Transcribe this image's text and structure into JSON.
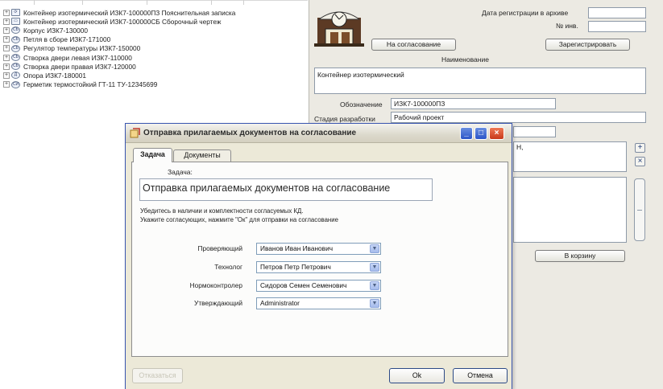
{
  "tree": {
    "items": [
      {
        "icon": "document-link-icon",
        "label": "Контейнер изотермический ИЗК7-100000ПЗ Пояснительная записка"
      },
      {
        "icon": "document-icon",
        "label": "Контейнер изотермический ИЗК7-100000СБ Сборочный чертеж"
      },
      {
        "icon": "assembly-icon",
        "label": "Корпус ИЗК7-130000"
      },
      {
        "icon": "assembly-icon",
        "label": "Петля в сборе ИЗК7-171000"
      },
      {
        "icon": "assembly-icon",
        "label": "Регулятор температуры ИЗК7-150000"
      },
      {
        "icon": "assembly-icon",
        "label": "Створка двери левая ИЗК7-110000"
      },
      {
        "icon": "assembly-icon",
        "label": "Створка двери правая ИЗК7-120000"
      },
      {
        "icon": "part-icon",
        "label": "Опора ИЗК7-180001"
      },
      {
        "icon": "standard-part-icon",
        "label": "Герметик термостойкий ГТ-11 ТУ-12345699"
      }
    ]
  },
  "form": {
    "archive_date_label": "Дата регистрации в архиве",
    "inventory_label": "№ инв.",
    "approval_button": "На согласование",
    "register_button": "Зарегистрировать",
    "name_label": "Наименование",
    "name_value": "Контейнер изотермический",
    "designation_label": "Обозначение",
    "designation_value": "ИЗК7-100000ПЗ",
    "stage_label": "Стадия разработки",
    "stage_value": "Рабочий проект",
    "side_text": "Н,",
    "cart_button": "В корзину"
  },
  "dialog": {
    "title": "Отправка прилагаемых документов на согласование",
    "tabs": [
      "Задача",
      "Документы"
    ],
    "task_label": "Задача:",
    "task_text": "Отправка прилагаемых документов на согласование",
    "hint_line1": "Убедитесь в наличии и комплектности согласуемых КД.",
    "hint_line2": "Укажите согласующих, нажмите \"Ок\" для отправки на согласование",
    "roles": [
      {
        "label": "Проверяющий",
        "value": "Иванов Иван Иванович"
      },
      {
        "label": "Технолог",
        "value": "Петров Петр Петрович"
      },
      {
        "label": "Нормоконтролер",
        "value": "Сидоров Семен Семенович"
      },
      {
        "label": "Утверждающий",
        "value": "Administrator"
      }
    ],
    "buttons": {
      "cancel_task": "Отказаться",
      "ok": "Ok",
      "cancel": "Отмена"
    }
  },
  "colors": {
    "form_background": "#eceae3",
    "dialog_background": "#ece9d8",
    "title_close_button": "#c8381a",
    "title_buttons": "#2b55c8"
  }
}
